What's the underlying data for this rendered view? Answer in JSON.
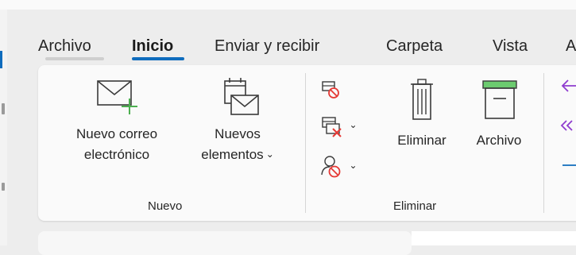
{
  "tabs": [
    {
      "label": "Archivo"
    },
    {
      "label": "Inicio"
    },
    {
      "label": "Enviar y recibir"
    },
    {
      "label": "Carpeta"
    },
    {
      "label": "Vista"
    },
    {
      "label": "A"
    }
  ],
  "ribbon": {
    "new_group": {
      "label": "Nuevo",
      "new_mail": {
        "line1": "Nuevo correo",
        "line2": "electrónico"
      },
      "new_items": {
        "line1": "Nuevos",
        "line2": "elementos"
      }
    },
    "delete_group": {
      "label": "Eliminar",
      "delete": {
        "label": "Eliminar"
      },
      "archive": {
        "label": "Archivo"
      }
    }
  },
  "colors": {
    "accent": "#0f6cbd",
    "green": "#6ccb6f",
    "red": "#e53935",
    "purple": "#8f3ccf"
  }
}
